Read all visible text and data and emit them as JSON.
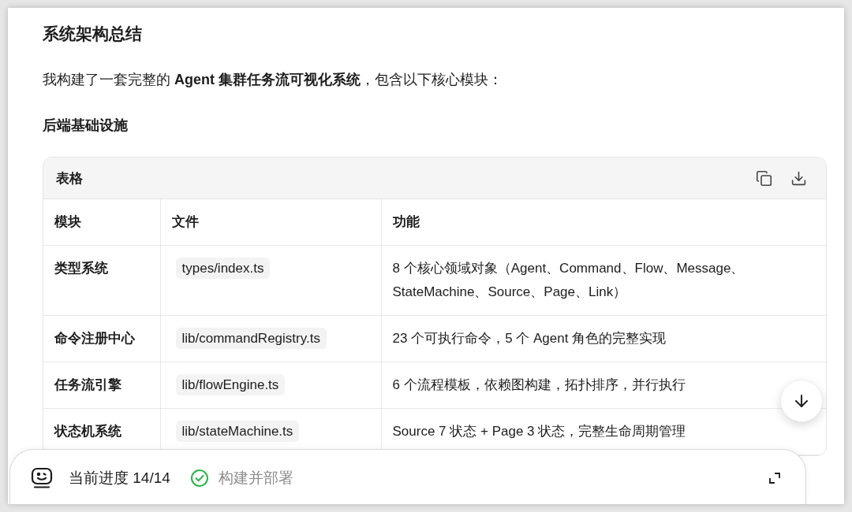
{
  "heading": "系统架构总结",
  "intro": "我构建了一套完整的 **Agent 集群任务流可视化系统**，包含以下核心模块：",
  "section_title": "后端基础设施",
  "table": {
    "title": "表格",
    "columns": [
      "模块",
      "文件",
      "功能"
    ],
    "rows": [
      {
        "module": "类型系统",
        "file": "types/index.ts",
        "description": "8 个核心领域对象（Agent、Command、Flow、Message、StateMachine、Source、Page、Link）"
      },
      {
        "module": "命令注册中心",
        "file": "lib/commandRegistry.ts",
        "description": "23 个可执行命令，5 个 Agent 角色的完整实现"
      },
      {
        "module": "任务流引擎",
        "file": "lib/flowEngine.ts",
        "description": "6 个流程模板，依赖图构建，拓扑排序，并行执行"
      },
      {
        "module": "状态机系统",
        "file": "lib/stateMachine.ts",
        "description": "Source 7 状态 + Page 3 状态，完整生命周期管理"
      }
    ]
  },
  "progress": {
    "label": "当前进度 14/14",
    "task": {
      "label": "构建并部署",
      "done": true
    }
  }
}
